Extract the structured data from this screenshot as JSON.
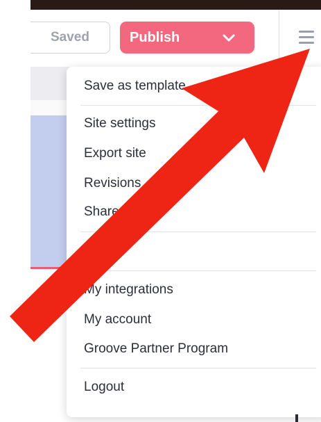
{
  "toolbar": {
    "saved_label": "Saved",
    "publish_label": "Publish"
  },
  "menu": {
    "items": [
      {
        "label": "Save as template"
      },
      {
        "label": "Site settings"
      },
      {
        "label": "Export site"
      },
      {
        "label": "Revisions"
      },
      {
        "label": "Share"
      },
      {
        "label": "My integrations"
      },
      {
        "label": "My account"
      },
      {
        "label": "Groove Partner Program"
      },
      {
        "label": "Logout"
      }
    ]
  },
  "colors": {
    "publish": "#f3677f",
    "arrow": "#ee2414",
    "text": "#2b2f38"
  },
  "icons": [
    "chevron-down-icon",
    "hamburger-menu-icon",
    "annotation-arrow"
  ]
}
